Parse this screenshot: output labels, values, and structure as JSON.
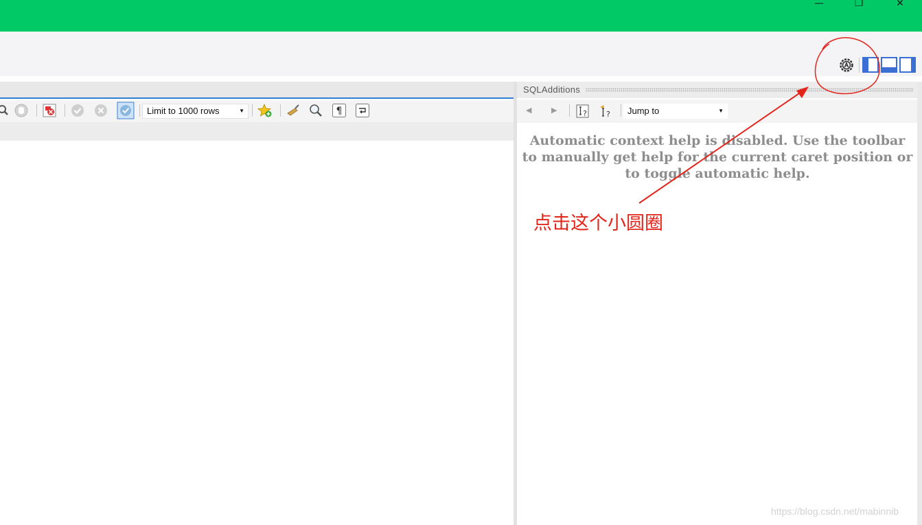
{
  "window": {
    "controls": [
      "—",
      "❐",
      "✕"
    ],
    "titlebar_color": "#00c966"
  },
  "editor_toolbar": {
    "icons": [
      "search-icon",
      "stop-hand-icon",
      "stop-on-error-icon",
      "commit-icon",
      "rollback-icon",
      "autocommit-toggle-icon",
      "favorite-add-icon",
      "beautify-icon",
      "find-icon",
      "invisible-chars-icon",
      "wrap-lines-icon"
    ],
    "limit_select": "Limit to 1000 rows"
  },
  "sql_additions": {
    "title": "SQLAdditions",
    "jump_select": "Jump to",
    "help_text": "Automatic context help is disabled. Use the toolbar to manually get help for the current caret position or to toggle automatic help."
  },
  "annotation": {
    "text": "点击这个小圆圈",
    "color": "#e3241b"
  },
  "watermark": "https://blog.csdn.net/mabinnib"
}
